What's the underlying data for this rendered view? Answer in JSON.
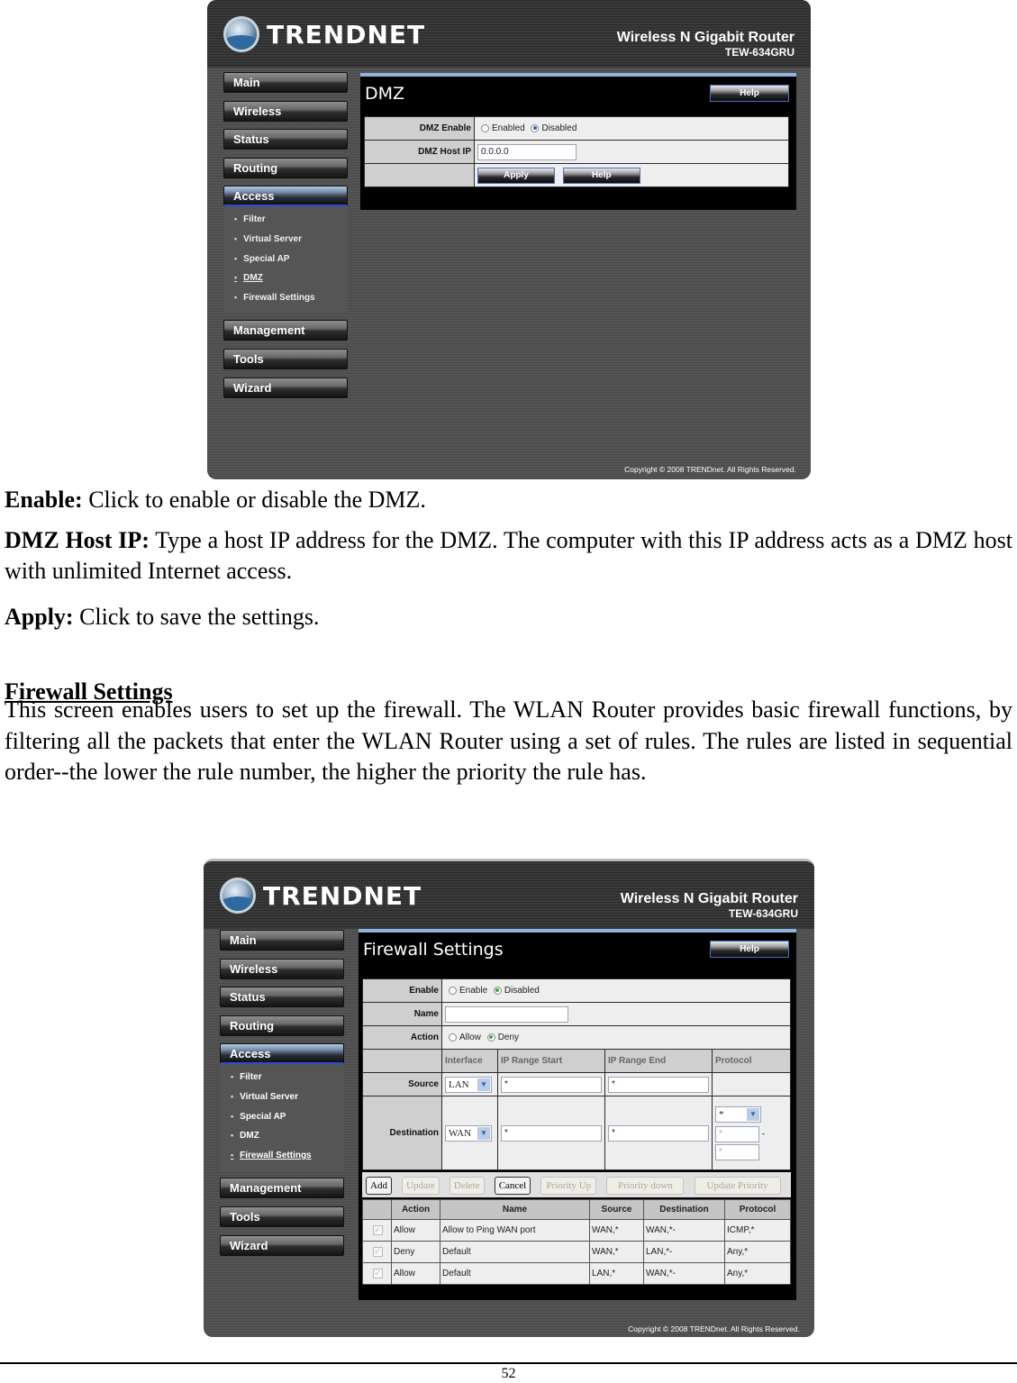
{
  "screenshot1": {
    "brand": "TRENDNET",
    "product_name": "Wireless N Gigabit Router",
    "model": "TEW-634GRU",
    "nav": {
      "main": "Main",
      "wireless": "Wireless",
      "status": "Status",
      "routing": "Routing",
      "access": "Access",
      "access_sub": [
        "Filter",
        "Virtual Server",
        "Special AP",
        "DMZ",
        "Firewall Settings"
      ],
      "management": "Management",
      "tools": "Tools",
      "wizard": "Wizard"
    },
    "panel_title": "DMZ",
    "help_label": "Help",
    "dmz_enable_label": "DMZ Enable",
    "enabled_label": "Enabled",
    "disabled_label": "Disabled",
    "selected": "Disabled",
    "host_ip_label": "DMZ Host IP",
    "host_ip_value": "0.0.0.0",
    "apply_label": "Apply",
    "help_label_2": "Help",
    "copyright": "Copyright © 2008 TRENDnet. All Rights Reserved."
  },
  "text": {
    "enable_term": "Enable:",
    "enable_desc": " Click to enable or disable the DMZ.",
    "hostip_term": "DMZ Host IP:",
    "hostip_desc": " Type a host IP address for the DMZ. The computer with this IP address acts as a DMZ host with unlimited Internet access.",
    "apply_term": "Apply:",
    "apply_desc": " Click to save the settings.",
    "section_heading": "Firewall Settings",
    "section_body": "This screen enables users to set up the firewall. The WLAN Router provides basic firewall functions, by filtering all the packets that enter the WLAN Router using a set of rules. The rules are listed in sequential order--the lower the rule number, the higher the priority the rule has."
  },
  "screenshot2": {
    "brand": "TRENDNET",
    "product_name": "Wireless N Gigabit Router",
    "model": "TEW-634GRU",
    "nav": {
      "main": "Main",
      "wireless": "Wireless",
      "status": "Status",
      "routing": "Routing",
      "access": "Access",
      "access_sub": [
        "Filter",
        "Virtual Server",
        "Special AP",
        "DMZ",
        "Firewall Settings"
      ],
      "management": "Management",
      "tools": "Tools",
      "wizard": "Wizard"
    },
    "panel_title": "Firewall Settings",
    "help_label": "Help",
    "enable_label": "Enable",
    "enable_opt": "Enable",
    "disabled_opt": "Disabled",
    "name_label": "Name",
    "name_value": "",
    "action_label": "Action",
    "allow_opt": "Allow",
    "deny_opt": "Deny",
    "col_interface": "Interface",
    "col_ip_start": "IP Range Start",
    "col_ip_end": "IP Range End",
    "col_protocol": "Protocol",
    "source_label": "Source",
    "source_interface": "LAN",
    "source_ip_start": "*",
    "source_ip_end": "*",
    "destination_label": "Destination",
    "dest_interface": "WAN",
    "dest_ip_start": "*",
    "dest_ip_end": "*",
    "dest_protocol": "*",
    "dest_port_start_placeholder": "*",
    "dest_port_end_placeholder": "*",
    "port_dash": "-",
    "buttons": {
      "add": "Add",
      "update": "Update",
      "delete": "Delete",
      "cancel": "Cancel",
      "priority_up": "Priority Up",
      "priority_down": "Priority down",
      "update_priority": "Update Priority"
    },
    "rules_headers": [
      "",
      "Action",
      "Name",
      "Source",
      "Destination",
      "Protocol"
    ],
    "rules": [
      {
        "action": "Allow",
        "name": "Allow to Ping WAN port",
        "source": "WAN,*",
        "destination": "WAN,*-",
        "protocol": "ICMP,*"
      },
      {
        "action": "Deny",
        "name": "Default",
        "source": "WAN,*",
        "destination": "LAN,*-",
        "protocol": "Any,*"
      },
      {
        "action": "Allow",
        "name": "Default",
        "source": "LAN,*",
        "destination": "WAN,*-",
        "protocol": "Any,*"
      }
    ],
    "copyright": "Copyright © 2008 TRENDnet. All Rights Reserved."
  },
  "page_number": "52"
}
